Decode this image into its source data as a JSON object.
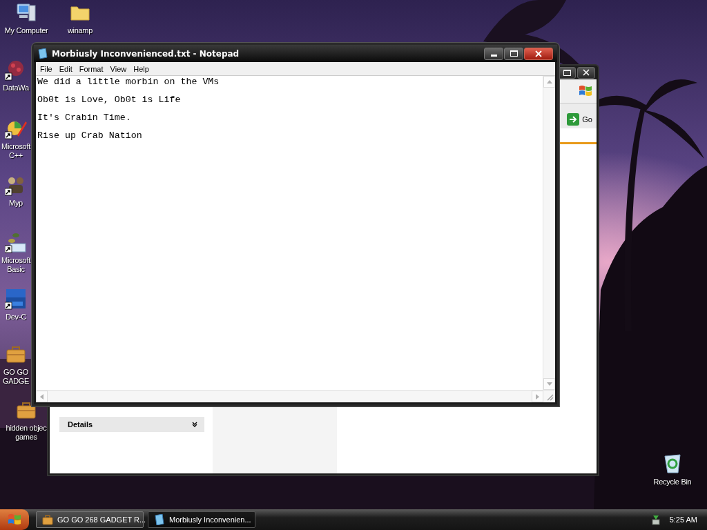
{
  "desktop": {
    "icons": [
      {
        "label": "My Computer",
        "kind": "computer",
        "shortcut": false
      },
      {
        "label": "winamp",
        "kind": "folder",
        "shortcut": false
      },
      {
        "label": "DataWa",
        "kind": "dots",
        "shortcut": true
      },
      {
        "label": "Microsoft C++",
        "kind": "palette",
        "shortcut": true
      },
      {
        "label": "Myp",
        "kind": "figures",
        "shortcut": true
      },
      {
        "label": "Microsoft Basic",
        "kind": "basic",
        "shortcut": true
      },
      {
        "label": "Dev-C",
        "kind": "devc",
        "shortcut": true
      },
      {
        "label": "GO GO GADGE",
        "kind": "briefcase",
        "shortcut": false
      },
      {
        "label": "hidden objec games",
        "kind": "briefcase",
        "shortcut": false
      },
      {
        "label": "Recycle Bin",
        "kind": "recycle",
        "shortcut": false
      }
    ]
  },
  "background_window": {
    "go_button": "Go",
    "details_panel": {
      "title": "Details"
    }
  },
  "notepad": {
    "title": "Morbiusly Inconvenienced.txt - Notepad",
    "menu": [
      "File",
      "Edit",
      "Format",
      "View",
      "Help"
    ],
    "lines": [
      "We did a little morbin on the VMs",
      "Ob0t is Love, Ob0t is Life",
      "It's Crabin Time.",
      "Rise up Crab Nation"
    ]
  },
  "taskbar": {
    "tasks": [
      {
        "label": "GO GO 268 GADGET R...",
        "kind": "briefcase",
        "selected": false
      },
      {
        "label": "Morbiusly Inconvenien...",
        "kind": "notepad",
        "selected": true
      }
    ],
    "clock": "5:25 AM"
  }
}
